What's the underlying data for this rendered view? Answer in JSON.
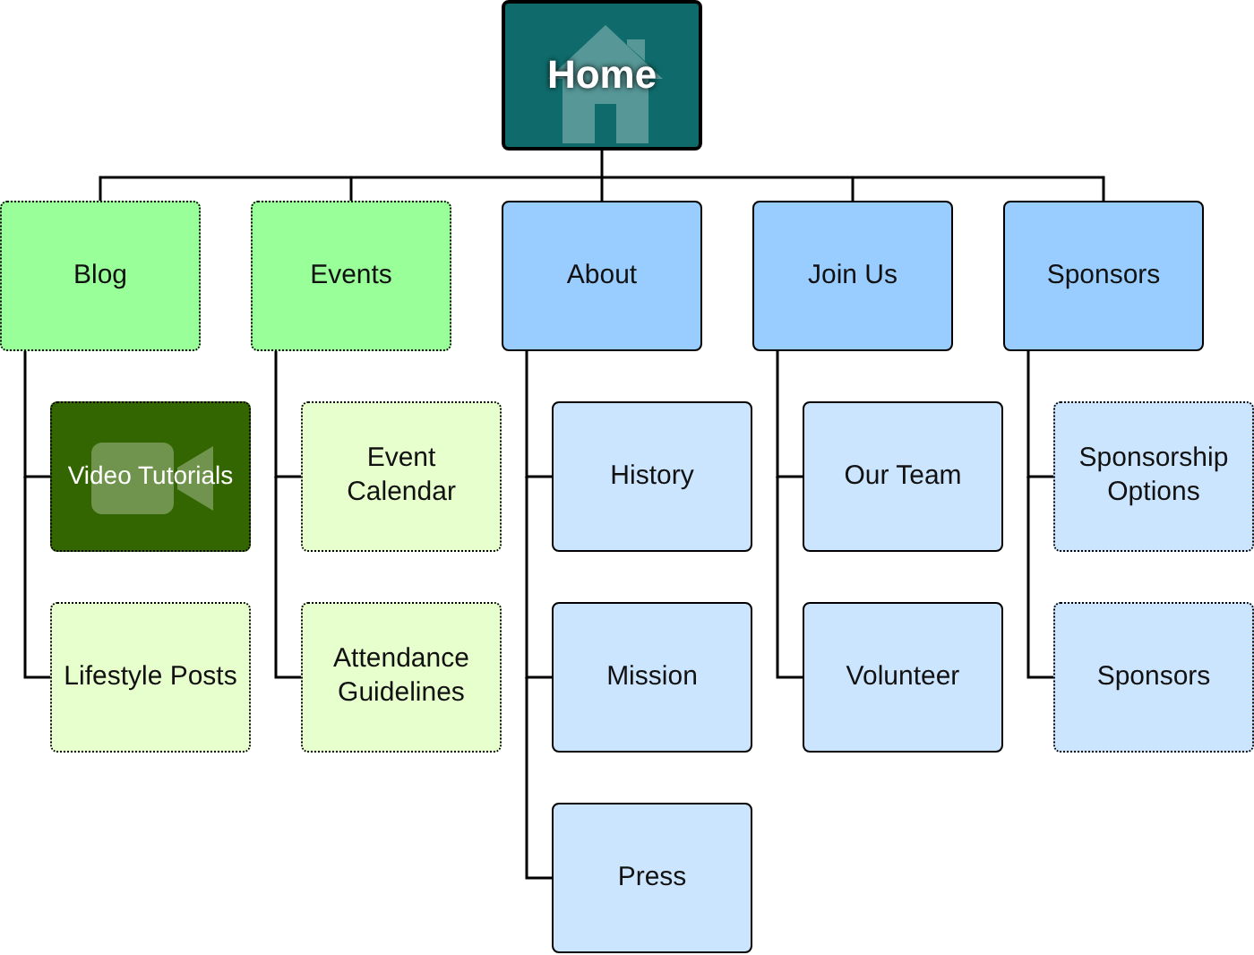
{
  "home": {
    "label": "Home",
    "color": "#0f6b6b",
    "kind": "home"
  },
  "sections": [
    {
      "label": "Blog",
      "color": "#99ff99",
      "kind": "draft",
      "children": [
        {
          "label": "Video Tutorials",
          "color": "#336600",
          "kind": "video"
        },
        {
          "label": "Lifestyle Posts",
          "color": "#e6ffcc",
          "kind": "draft"
        }
      ]
    },
    {
      "label": "Events",
      "color": "#99ff99",
      "kind": "draft",
      "children": [
        {
          "label": "Event Calendar",
          "color": "#e6ffcc",
          "kind": "draft"
        },
        {
          "label": "Attendance Guidelines",
          "color": "#e6ffcc",
          "kind": "draft"
        }
      ]
    },
    {
      "label": "About",
      "color": "#99ccff",
      "kind": "page",
      "children": [
        {
          "label": "History",
          "color": "#cce5ff",
          "kind": "page"
        },
        {
          "label": "Mission",
          "color": "#cce5ff",
          "kind": "page"
        },
        {
          "label": "Press",
          "color": "#cce5ff",
          "kind": "page"
        }
      ]
    },
    {
      "label": "Join Us",
      "color": "#99ccff",
      "kind": "page",
      "children": [
        {
          "label": "Our Team",
          "color": "#cce5ff",
          "kind": "page"
        },
        {
          "label": "Volunteer",
          "color": "#cce5ff",
          "kind": "page"
        }
      ]
    },
    {
      "label": "Sponsors",
      "color": "#99ccff",
      "kind": "page",
      "children": [
        {
          "label": "Sponsorship Options",
          "color": "#cce5ff",
          "kind": "draft"
        },
        {
          "label": "Sponsors",
          "color": "#cce5ff",
          "kind": "draft"
        }
      ]
    }
  ]
}
